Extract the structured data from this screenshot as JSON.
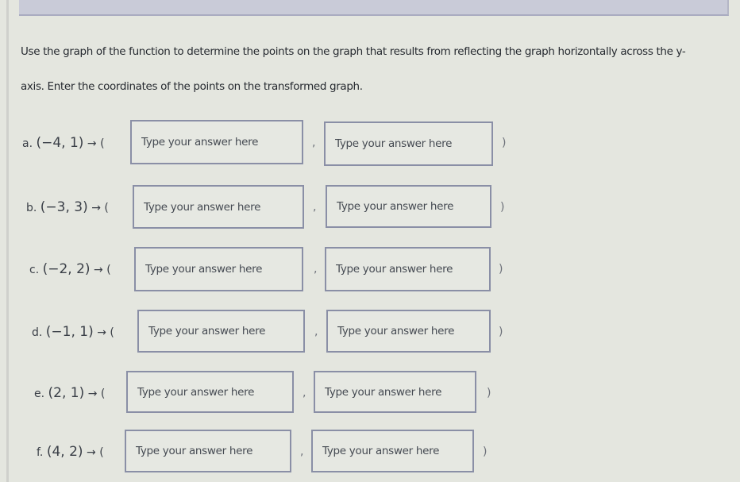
{
  "question": {
    "line1": "Use the graph of the function to determine the points on the graph that results from reflecting the graph horizontally across the y-",
    "line2": "axis. Enter the coordinates of the points on the transformed graph."
  },
  "arrow": "→",
  "open_paren": "(",
  "close_paren": ")",
  "comma": ",",
  "items": [
    {
      "letter": "a.",
      "point": "(−4, 1)",
      "x_placeholder": "Type your answer here",
      "y_placeholder": "Type your answer here",
      "x_value": "",
      "y_value": ""
    },
    {
      "letter": "b.",
      "point": "(−3, 3)",
      "x_placeholder": "Type your answer here",
      "y_placeholder": "Type your answer here",
      "x_value": "",
      "y_value": ""
    },
    {
      "letter": "c.",
      "point": "(−2, 2)",
      "x_placeholder": "Type your answer here",
      "y_placeholder": "Type your answer here",
      "x_value": "",
      "y_value": ""
    },
    {
      "letter": "d.",
      "point": "(−1, 1)",
      "x_placeholder": "Type your answer here",
      "y_placeholder": "Type your answer here",
      "x_value": "",
      "y_value": ""
    },
    {
      "letter": "e.",
      "point": "(2, 1)",
      "x_placeholder": "Type your answer here",
      "y_placeholder": "Type your answer here",
      "x_value": "",
      "y_value": ""
    },
    {
      "letter": "f.",
      "point": "(4, 2)",
      "x_placeholder": "Type your answer here",
      "y_placeholder": "Type your answer here",
      "x_value": "",
      "y_value": ""
    }
  ]
}
